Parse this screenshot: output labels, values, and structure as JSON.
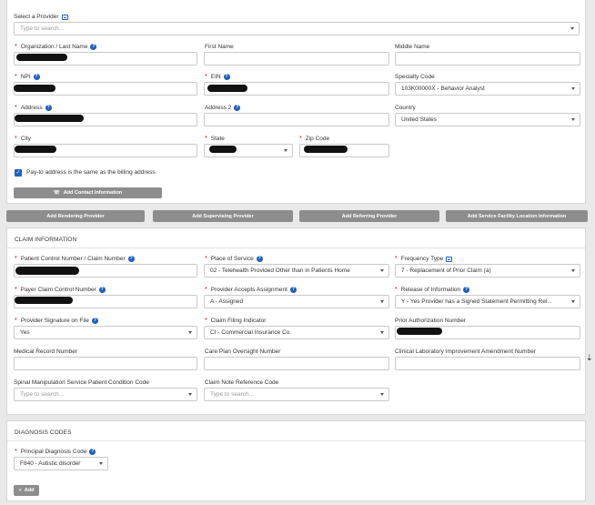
{
  "contact": {
    "provider_select_label": "Select a Provider",
    "provider_select_placeholder": "Type to search...",
    "org_label": "Organization / Last Name",
    "first_name_label": "First Name",
    "middle_name_label": "Middle Name",
    "npi_label": "NPI",
    "ein_label": "EIN",
    "specialty_label": "Specialty Code",
    "specialty_value": "103K00000X - Behavior Analyst",
    "address_label": "Address",
    "address2_label": "Address 2",
    "country_label": "Country",
    "country_value": "United States",
    "city_label": "City",
    "state_label": "State",
    "zip_label": "Zip Code",
    "payto_label": "Pay-to address is the same as the billing address",
    "add_contact_button": "Add Contact Information"
  },
  "buttons": {
    "rendering": "Add Rendering Provider",
    "supervising": "Add Supervising Provider",
    "referring": "Add Referring Provider",
    "facility": "Add Service Facility Location Information"
  },
  "claim": {
    "title": "CLAIM INFORMATION",
    "patient_control_label": "Patient Control Number / Claim Number",
    "place_of_service_label": "Place of Service",
    "place_of_service_value": "02 - Telehealth Provided Other than in Patients Home",
    "frequency_label": "Frequency Type",
    "frequency_value": "7 - Replacement of Prior Claim (a)",
    "payer_control_label": "Payer Claim Control Number",
    "accepts_assignment_label": "Provider Accepts Assignment",
    "accepts_assignment_value": "A - Assigned",
    "release_label": "Release of Information",
    "release_value": "Y - Yes Provider has a Signed Statement Permitting Rel...",
    "signature_label": "Provider Signature on File",
    "signature_value": "Yes",
    "filing_label": "Claim Filing Indicator",
    "filing_value": "CI - Commercial Insurance Co.",
    "prior_auth_label": "Prior Authorization Number",
    "medical_record_label": "Medical Record Number",
    "care_plan_label": "Care Plan Oversight Number",
    "clia_label": "Clinical Laboratory Improvement Amendment Number",
    "spinal_label": "Spinal Manipulation Service Patient Condition Code",
    "spinal_placeholder": "Type to search...",
    "claim_note_label": "Claim Note Reference Code",
    "claim_note_placeholder": "Type to search..."
  },
  "diagnosis": {
    "title": "DIAGNOSIS CODES",
    "principal_label": "Principal Diagnosis Code",
    "principal_value": "F840 - Autistic disorder",
    "add_button": "Add"
  },
  "colors": {
    "accent": "#1f5fbf",
    "required": "#d0021b",
    "button": "#8d8d8d"
  }
}
